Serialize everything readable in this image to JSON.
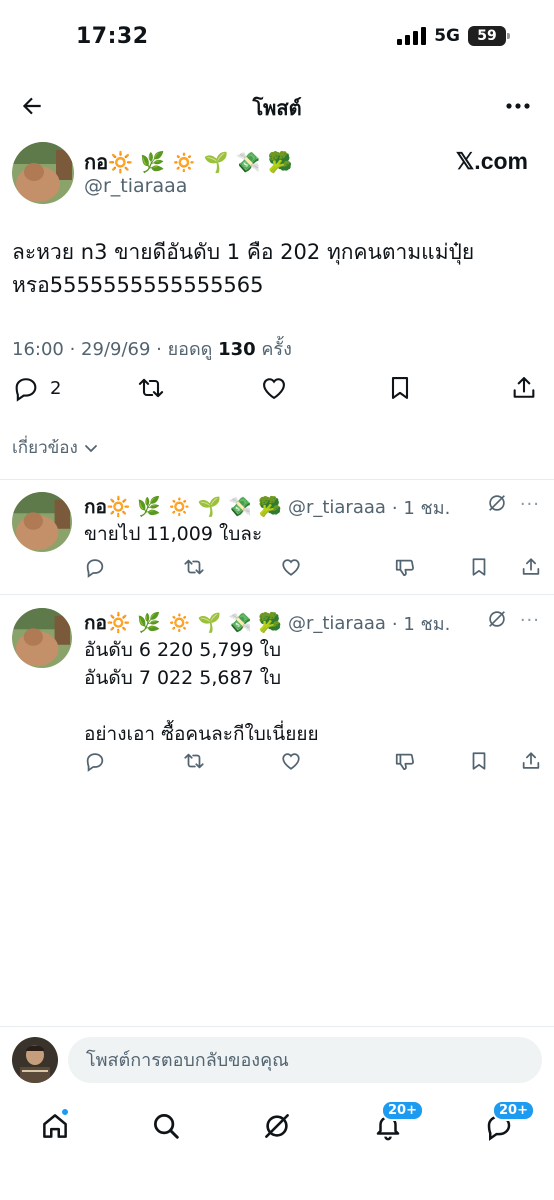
{
  "status_bar": {
    "time": "17:32",
    "network": "5G",
    "battery": "59"
  },
  "header": {
    "title": "โพสต์"
  },
  "post": {
    "author_name": "กอ🔆 🌿 🔅 🌱 💸 🥦",
    "handle": "@r_tiaraaa",
    "source": "𝕏.com",
    "text": "ละหวย n3 ขายดีอันดับ 1 คือ 202 ทุกคนตามแม่ปุ๋ย หรอ5555555555555565",
    "time": "16:00 · 29/9/69 · ยอดดู ",
    "views": "130",
    "views_suffix": " ครั้ง",
    "reply_count": "2"
  },
  "related_label": "เกี่ยวข้อง",
  "replies": [
    {
      "author_name": "กอ🔆 🌿 🔅 🌱 💸 🥦",
      "handle": "@r_tiaraaa",
      "time": "· 1 ชม.",
      "text": "ขายไป 11,009 ใบละ",
      "more": "···"
    },
    {
      "author_name": "กอ🔆 🌿 🔅 🌱 💸 🥦",
      "handle": "@r_tiaraaa",
      "time": "· 1 ชม.",
      "text": "อันดับ 6 220 5,799 ใบ\nอันดับ 7 022 5,687 ใบ\n\nอย่างเอา ซื้อคนละกีใบเนี่ยยย",
      "more": "···"
    }
  ],
  "compose": {
    "placeholder": "โพสต์การตอบกลับของคุณ"
  },
  "nav": {
    "notif_badge": "20+",
    "msg_badge": "20+"
  },
  "icons": {
    "back": "arrow-left-icon",
    "more": "more-icon",
    "reply": "reply-icon",
    "repost": "repost-icon",
    "like": "heart-icon",
    "bookmark": "bookmark-icon",
    "share": "share-icon",
    "grok": "grok-icon",
    "dislike": "thumbs-down-icon",
    "home": "home-icon",
    "search": "search-icon",
    "bell": "bell-icon",
    "messages": "messages-icon",
    "chevron": "chevron-down-icon"
  },
  "colors": {
    "accent": "#1d9bf0",
    "text": "#0f1419",
    "muted": "#536471"
  }
}
